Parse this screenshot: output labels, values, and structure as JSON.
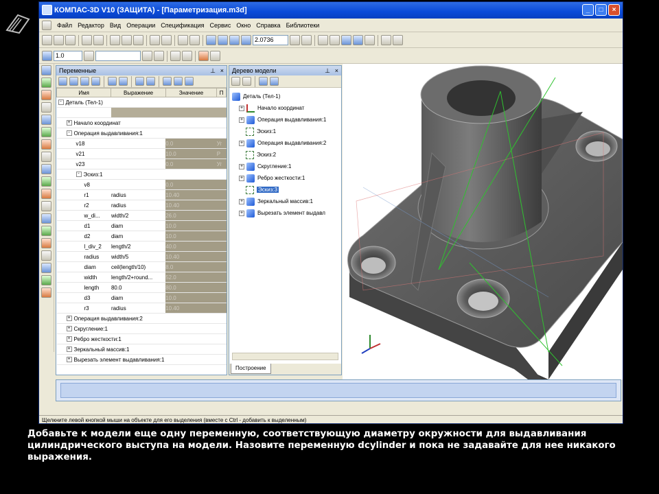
{
  "window": {
    "title": "КОМПАС-3D V10 (ЗАЩИТА) - [Параметризация.m3d]"
  },
  "menu": [
    "Файл",
    "Редактор",
    "Вид",
    "Операции",
    "Спецификация",
    "Сервис",
    "Окно",
    "Справка",
    "Библиотеки"
  ],
  "toolbar": {
    "zoom_value": "2.0736",
    "line_style_value": "1.0"
  },
  "variables_panel": {
    "title": "Переменные",
    "columns": [
      "Имя",
      "Выражение",
      "Значение",
      "П"
    ],
    "root": "Деталь (Тел-1)",
    "rows": [
      {
        "level": 1,
        "name": "Начало координат",
        "expr": "",
        "value": "",
        "toggle": "+"
      },
      {
        "level": 1,
        "name": "Операция выдавливания:1",
        "expr": "",
        "value": "",
        "toggle": "-"
      },
      {
        "level": 2,
        "name": "v18",
        "expr": "",
        "value": "0.0",
        "com": "Уг"
      },
      {
        "level": 2,
        "name": "v21",
        "expr": "",
        "value": "10.0",
        "com": "Р"
      },
      {
        "level": 2,
        "name": "v23",
        "expr": "",
        "value": "0.0",
        "com": "Уг"
      },
      {
        "level": 2,
        "name": "Эскиз:1",
        "expr": "",
        "value": "",
        "toggle": "-"
      },
      {
        "level": 3,
        "name": "v8",
        "expr": "",
        "value": "0.0",
        "com": ""
      },
      {
        "level": 3,
        "name": "r1",
        "expr": "radius",
        "value": "10.40",
        "com": ""
      },
      {
        "level": 3,
        "name": "r2",
        "expr": "radius",
        "value": "10.40",
        "com": ""
      },
      {
        "level": 3,
        "name": "w_di...",
        "expr": "width/2",
        "value": "26.0",
        "com": ""
      },
      {
        "level": 3,
        "name": "d1",
        "expr": "diam",
        "value": "10.0",
        "com": ""
      },
      {
        "level": 3,
        "name": "d2",
        "expr": "diam",
        "value": "10.0",
        "com": ""
      },
      {
        "level": 3,
        "name": "l_div_2",
        "expr": "length/2",
        "value": "40.0",
        "com": ""
      },
      {
        "level": 3,
        "name": "radius",
        "expr": "width/5",
        "value": "10.40",
        "com": ""
      },
      {
        "level": 3,
        "name": "diam",
        "expr": "ceil(length/10)",
        "value": "8.0",
        "com": ""
      },
      {
        "level": 3,
        "name": "width",
        "expr": "length/2+round...",
        "value": "52.0",
        "com": ""
      },
      {
        "level": 3,
        "name": "length",
        "expr": "80.0",
        "value": "80.0",
        "com": ""
      },
      {
        "level": 3,
        "name": "d3",
        "expr": "diam",
        "value": "10.0",
        "com": ""
      },
      {
        "level": 3,
        "name": "r3",
        "expr": "radius",
        "value": "10.40",
        "com": ""
      },
      {
        "level": 1,
        "name": "Операция выдавливания:2",
        "expr": "",
        "value": "",
        "toggle": "+"
      },
      {
        "level": 1,
        "name": "Скругление:1",
        "expr": "",
        "value": "",
        "toggle": "+"
      },
      {
        "level": 1,
        "name": "Ребро жесткости:1",
        "expr": "",
        "value": "",
        "toggle": "+"
      },
      {
        "level": 1,
        "name": "Зеркальный массив:1",
        "expr": "",
        "value": "",
        "toggle": "+"
      },
      {
        "level": 1,
        "name": "Вырезать элемент выдавливания:1",
        "expr": "",
        "value": "",
        "toggle": "+"
      }
    ]
  },
  "tree_panel": {
    "title": "Дерево модели",
    "nodes": [
      {
        "level": 0,
        "label": "Деталь (Тел-1)",
        "icon": "part-icon"
      },
      {
        "level": 1,
        "label": "Начало координат",
        "icon": "origin-icon"
      },
      {
        "level": 1,
        "label": "Операция выдавливания:1",
        "icon": "extrude-icon"
      },
      {
        "level": 2,
        "label": "Эскиз:1",
        "icon": "sketch-icon"
      },
      {
        "level": 1,
        "label": "Операция выдавливания:2",
        "icon": "extrude-icon"
      },
      {
        "level": 2,
        "label": "Эскиз:2",
        "icon": "sketch-icon"
      },
      {
        "level": 1,
        "label": "Скругление:1",
        "icon": "fillet-icon"
      },
      {
        "level": 1,
        "label": "Ребро жесткости:1",
        "icon": "rib-icon"
      },
      {
        "level": 2,
        "label": "Эскиз:3",
        "icon": "sketch-icon",
        "selected": true
      },
      {
        "level": 1,
        "label": "Зеркальный массив:1",
        "icon": "mirror-icon"
      },
      {
        "level": 1,
        "label": "Вырезать элемент выдавл",
        "icon": "cut-icon"
      }
    ],
    "tab": "Построение"
  },
  "status_text": "Щелкните левой кнопкой мыши на объекте для его выделения (вместе с Ctrl - добавить к выделенным)",
  "caption": "Добавьте к модели еще одну переменную, соответствующую диаметру окружности для выдавливания цилиндрического выступа на модели. Назовите переменную dcylinder и пока не задавайте для нее никакого выражения."
}
